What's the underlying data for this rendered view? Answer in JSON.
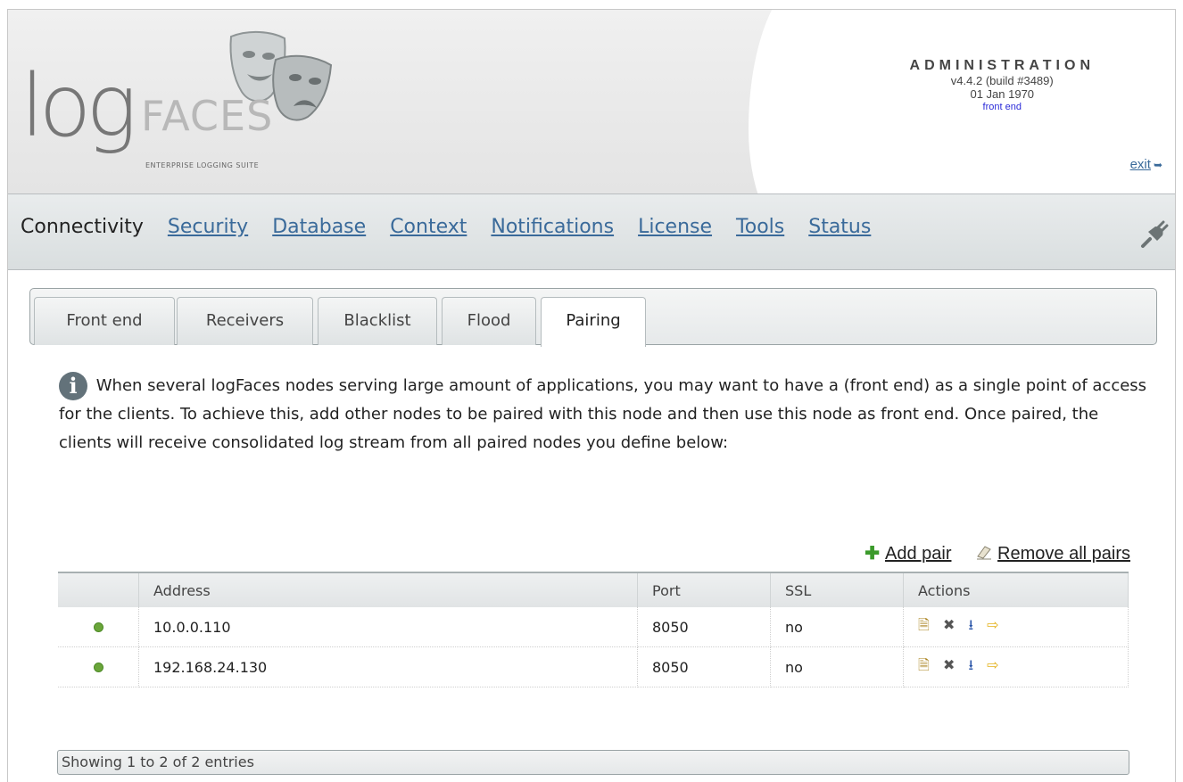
{
  "header": {
    "logo_log": "log",
    "logo_faces": "FACES",
    "logo_tagline": "ENTERPRISE LOGGING SUITE",
    "admin_title": "ADMINISTRATION",
    "version": "v4.4.2 (build #3489)",
    "date": "01 Jan 1970",
    "mode": "front end",
    "exit_label": "exit"
  },
  "nav": {
    "current": "Connectivity",
    "links": [
      "Security",
      "Database",
      "Context",
      "Notifications",
      "License",
      "Tools",
      "Status"
    ]
  },
  "tabs": {
    "items": [
      "Front end",
      "Receivers",
      "Blacklist",
      "Flood",
      "Pairing"
    ],
    "active": "Pairing"
  },
  "info": {
    "icon": "info-icon",
    "text": "When several logFaces nodes serving large amount of applications, you may want to have a (front end) as a single point of access for the clients. To achieve this, add other nodes to be paired with this node and then use this node as front end. Once paired, the clients will receive consolidated log stream from all paired nodes you define below:"
  },
  "actions": {
    "add_label": "Add pair",
    "remove_all_label": "Remove all pairs"
  },
  "table": {
    "columns": [
      "",
      "Address",
      "Port",
      "SSL",
      "Actions"
    ],
    "rows": [
      {
        "status": "online",
        "address": "10.0.0.110",
        "port": "8050",
        "ssl": "no"
      },
      {
        "status": "online",
        "address": "192.168.24.130",
        "port": "8050",
        "ssl": "no"
      }
    ],
    "row_actions": [
      "properties-icon",
      "delete-icon",
      "import-icon",
      "go-icon"
    ]
  },
  "footer": {
    "info": "Showing 1 to 2 of 2 entries"
  },
  "colors": {
    "link": "#3a6a9a",
    "status_online": "#6aa53a",
    "mode_text": "#2a2ad8"
  }
}
